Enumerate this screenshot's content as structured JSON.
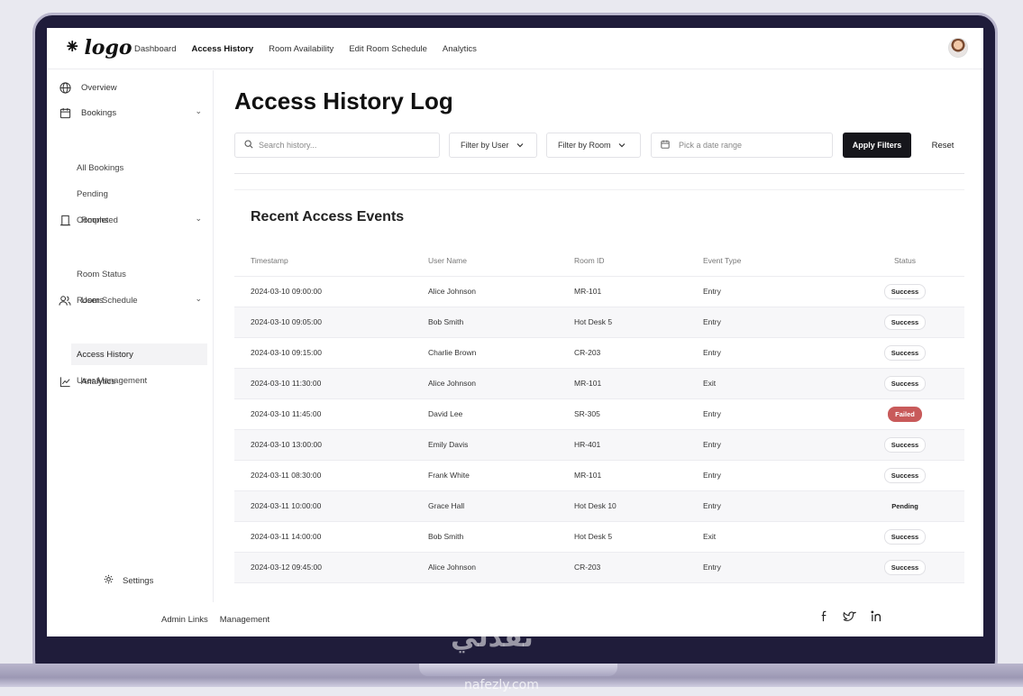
{
  "logo": {
    "text": "logo",
    "mark": "⁕"
  },
  "nav": [
    {
      "label": "Dashboard",
      "active": false
    },
    {
      "label": "Access History",
      "active": true
    },
    {
      "label": "Room Availability",
      "active": false
    },
    {
      "label": "Edit Room Schedule",
      "active": false
    },
    {
      "label": "Analytics",
      "active": false
    }
  ],
  "sidebar": {
    "overview": "Overview",
    "bookings": "Bookings",
    "bookings_items": [
      "All Bookings",
      "Pending",
      "Completed"
    ],
    "rooms": "Rooms",
    "rooms_items": [
      "Room Status",
      "Room Schedule"
    ],
    "users": "Users",
    "users_items": [
      "Access History",
      "User Management"
    ],
    "analytics": "Analytics",
    "settings": "Settings"
  },
  "page": {
    "title": "Access History Log"
  },
  "filters": {
    "search_placeholder": "Search history...",
    "filter_user": "Filter by User",
    "filter_room": "Filter by Room",
    "date_placeholder": "Pick a date range",
    "apply": "Apply Filters",
    "reset": "Reset"
  },
  "events": {
    "title": "Recent Access Events",
    "columns": [
      "Timestamp",
      "User Name",
      "Room ID",
      "Event Type",
      "Status"
    ],
    "rows": [
      [
        "2024-03-10 09:00:00",
        "Alice Johnson",
        "MR-101",
        "Entry",
        "Success"
      ],
      [
        "2024-03-10 09:05:00",
        "Bob Smith",
        "Hot Desk 5",
        "Entry",
        "Success"
      ],
      [
        "2024-03-10 09:15:00",
        "Charlie Brown",
        "CR-203",
        "Entry",
        "Success"
      ],
      [
        "2024-03-10 11:30:00",
        "Alice Johnson",
        "MR-101",
        "Exit",
        "Success"
      ],
      [
        "2024-03-10 11:45:00",
        "David Lee",
        "SR-305",
        "Entry",
        "Failed"
      ],
      [
        "2024-03-10 13:00:00",
        "Emily Davis",
        "HR-401",
        "Entry",
        "Success"
      ],
      [
        "2024-03-11 08:30:00",
        "Frank White",
        "MR-101",
        "Entry",
        "Success"
      ],
      [
        "2024-03-11 10:00:00",
        "Grace Hall",
        "Hot Desk 10",
        "Entry",
        "Pending"
      ],
      [
        "2024-03-11 14:00:00",
        "Bob Smith",
        "Hot Desk 5",
        "Exit",
        "Success"
      ],
      [
        "2024-03-12 09:45:00",
        "Alice Johnson",
        "CR-203",
        "Entry",
        "Success"
      ]
    ]
  },
  "footer": {
    "links": [
      "Admin Links",
      "Management"
    ],
    "social": [
      "facebook-icon",
      "twitter-icon",
      "linkedin-icon"
    ]
  },
  "watermark": {
    "text": "نفذلي",
    "sub": "nafezly.com"
  },
  "colors": {
    "primary_button": "#16161b",
    "failed_badge": "#c85a5a",
    "frame": "#1f1c3a"
  }
}
